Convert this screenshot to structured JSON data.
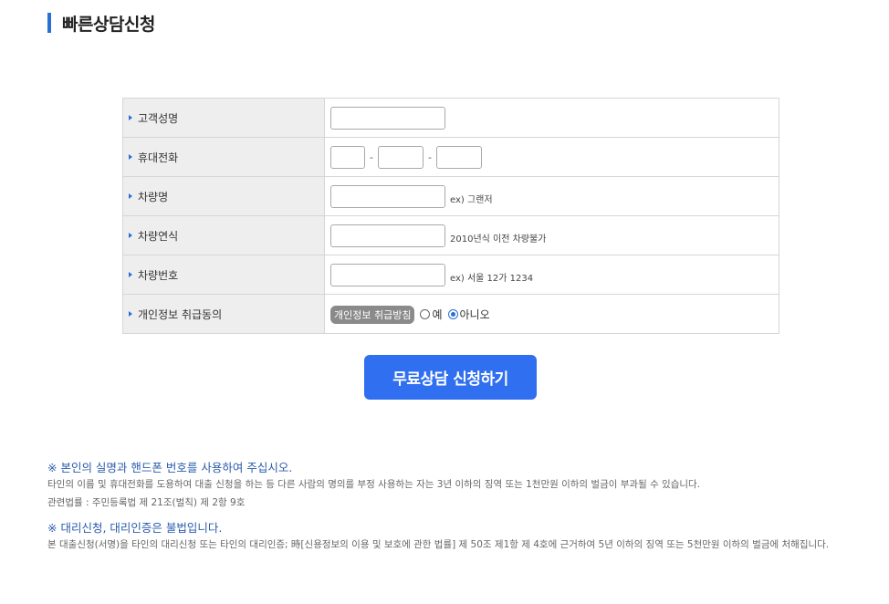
{
  "page": {
    "title": "빠른상담신청"
  },
  "form": {
    "rows": [
      {
        "label": "고객성명"
      },
      {
        "label": "휴대전화",
        "separator": "-"
      },
      {
        "label": "차량명",
        "hint": "ex) 그랜저"
      },
      {
        "label": "차량연식",
        "hint": "2010년식 이전 차량불가"
      },
      {
        "label": "차량번호",
        "hint": "ex) 서울 12가 1234"
      },
      {
        "label": "개인정보 취급동의",
        "policy_button": "개인정보 취급방침",
        "agree_yes": "예",
        "agree_no": "아니오",
        "selected": "아니오"
      }
    ]
  },
  "submit_label": "무료상담 신청하기",
  "notices": {
    "heading1": "※ 본인의 실명과 핸드폰 번호를 사용하여 주십시오.",
    "body1": "타인의 이름 및 휴대전화를 도용하여 대출 신청을 하는 등 다른 사람의 명의를 부정 사용하는 자는 3년 이하의 징역 또는 1천만원 이하의 벌금이 부과될 수 있습니다.",
    "body2": "관련법률 : 주민등록법 제 21조(벌칙) 제 2항 9호",
    "heading2": "※ 대리신청, 대리인증은 불법입니다.",
    "body3": "본 대출신청(서명)을 타인의 대리신청 또는 타인의 대리인증; 時[신용정보의 이용 및 보호에 관한 법률] 제 50조 제1항 제 4호에 근거하여 5년 이하의 징역 또는 5천만원 이하의 벌금에 처해집니다."
  },
  "colors": {
    "accent": "#2a6fd6",
    "button": "#2f6ff0",
    "label_bg": "#eeeeee"
  }
}
